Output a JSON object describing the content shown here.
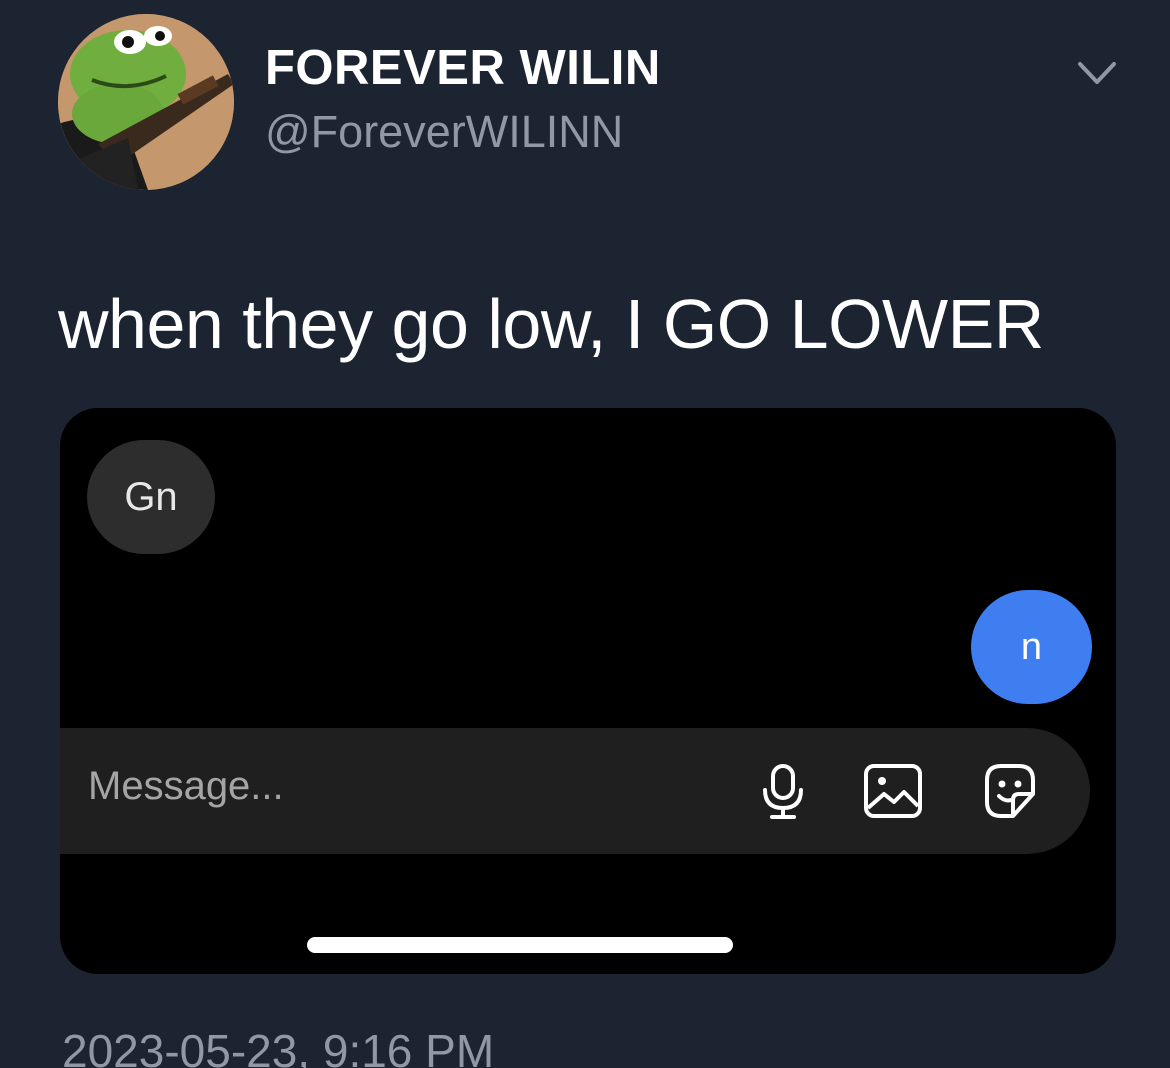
{
  "author": {
    "display_name": "FOREVER WILIN",
    "handle": "@ForeverWILINN",
    "avatar_icon": "frog-with-rifle-avatar"
  },
  "menu": {
    "icon": "chevron-down-icon"
  },
  "tweet": {
    "text": "when they go low, I GO LOWER",
    "timestamp": "2023-05-23, 9:16 PM"
  },
  "embedded_screenshot": {
    "messages": [
      {
        "direction": "incoming",
        "text": "Gn"
      },
      {
        "direction": "outgoing",
        "text": "n"
      }
    ],
    "composer": {
      "placeholder": "Message...",
      "icons": [
        "microphone-icon",
        "image-icon",
        "sticker-icon"
      ]
    }
  },
  "colors": {
    "background": "#1c2331",
    "outgoing_bubble": "#3f7ef0",
    "incoming_bubble": "#2d2d2d",
    "secondary_text": "#8f98a6"
  }
}
